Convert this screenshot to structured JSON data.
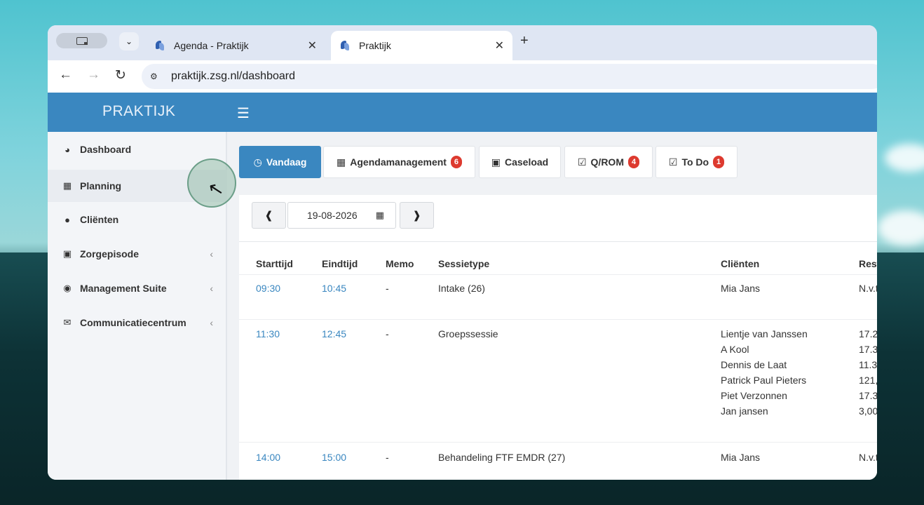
{
  "browser": {
    "tabs": [
      {
        "title": "Agenda - Praktijk",
        "active": false
      },
      {
        "title": "Praktijk",
        "active": true
      }
    ],
    "url": "praktijk.zsg.nl/dashboard"
  },
  "app": {
    "brand": "PRAKTIJK",
    "accent": "#3a87c0",
    "badge_color": "#dd3a2f"
  },
  "sidebar": {
    "items": [
      {
        "label": "Dashboard",
        "icon": "dashboard-icon",
        "submenu": false
      },
      {
        "label": "Planning",
        "icon": "calendar-icon",
        "submenu": false
      },
      {
        "label": "Cliënten",
        "icon": "user-icon",
        "submenu": false
      },
      {
        "label": "Zorgepisode",
        "icon": "briefcase-icon",
        "submenu": true
      },
      {
        "label": "Management Suite",
        "icon": "globe-icon",
        "submenu": true
      },
      {
        "label": "Communicatiecentrum",
        "icon": "envelope-icon",
        "submenu": true
      }
    ]
  },
  "main": {
    "tabs": [
      {
        "label": "Vandaag",
        "icon": "clock-icon",
        "badge": "",
        "active": true
      },
      {
        "label": "Agendamanagement",
        "icon": "calendar-icon",
        "badge": "6",
        "active": false
      },
      {
        "label": "Caseload",
        "icon": "caseload-icon",
        "badge": "",
        "active": false
      },
      {
        "label": "Q/ROM",
        "icon": "checkbox-icon",
        "badge": "4",
        "active": false
      },
      {
        "label": "To Do",
        "icon": "checkbox-icon",
        "badge": "1",
        "active": false
      }
    ],
    "date": "19-08-2026",
    "table": {
      "headers": [
        "Starttijd",
        "Eindtijd",
        "Memo",
        "Sessietype",
        "Cliënten",
        "Rest"
      ],
      "rows": [
        {
          "start": "09:30",
          "end": "10:45",
          "memo": "-",
          "type": "Intake (26)",
          "clients": [
            {
              "name": "Mia Jans",
              "rest": "N.v.t"
            }
          ]
        },
        {
          "start": "11:30",
          "end": "12:45",
          "memo": "-",
          "type": "Groepssessie",
          "clients": [
            {
              "name": "Lientje van Janssen",
              "rest": "17.2"
            },
            {
              "name": "A Kool",
              "rest": "17.3"
            },
            {
              "name": "Dennis de Laat",
              "rest": "11.3"
            },
            {
              "name": "Patrick Paul Pieters",
              "rest": "121,"
            },
            {
              "name": "Piet Verzonnen",
              "rest": "17.3"
            },
            {
              "name": "Jan jansen",
              "rest": "3,00"
            }
          ]
        },
        {
          "start": "14:00",
          "end": "15:00",
          "memo": "-",
          "type": "Behandeling FTF EMDR (27)",
          "clients": [
            {
              "name": "Mia Jans",
              "rest": "N.v.t"
            }
          ]
        }
      ]
    }
  }
}
